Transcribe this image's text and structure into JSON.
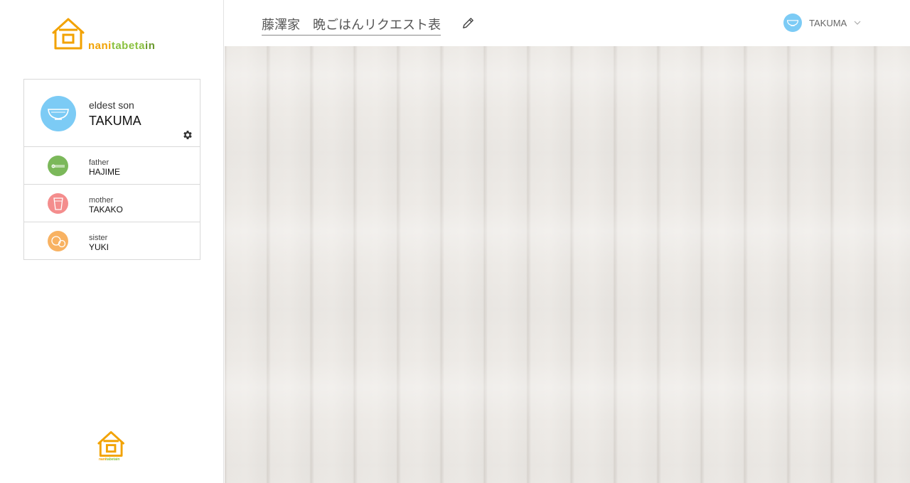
{
  "logo": {
    "part1": "nani",
    "part2": "tabeta",
    "part3": "in"
  },
  "current_member": {
    "role": "eldest son",
    "name": "TAKUMA",
    "icon": "bowl-icon",
    "color": "#7ccbf5"
  },
  "members": [
    {
      "role": "father",
      "name": "HAJIME",
      "icon": "chopsticks-icon",
      "color": "#7bb85a"
    },
    {
      "role": "mother",
      "name": "TAKAKO",
      "icon": "cup-icon",
      "color": "#f48d8d"
    },
    {
      "role": "sister",
      "name": "YUKI",
      "icon": "bubbles-icon",
      "color": "#f8b262"
    }
  ],
  "header": {
    "title": "藤澤家　晩ごはんリクエスト表",
    "edit_icon": "pencil-icon",
    "user": {
      "name": "TAKUMA",
      "icon": "bowl-icon",
      "menu_icon": "chevron-down-icon"
    }
  },
  "footer_logo": {
    "part1": "nani",
    "part2": "tabeta",
    "part3": "in"
  },
  "colors": {
    "orange": "#f2a200",
    "green": "#8ac13f",
    "wood": "#ebe8e4"
  }
}
